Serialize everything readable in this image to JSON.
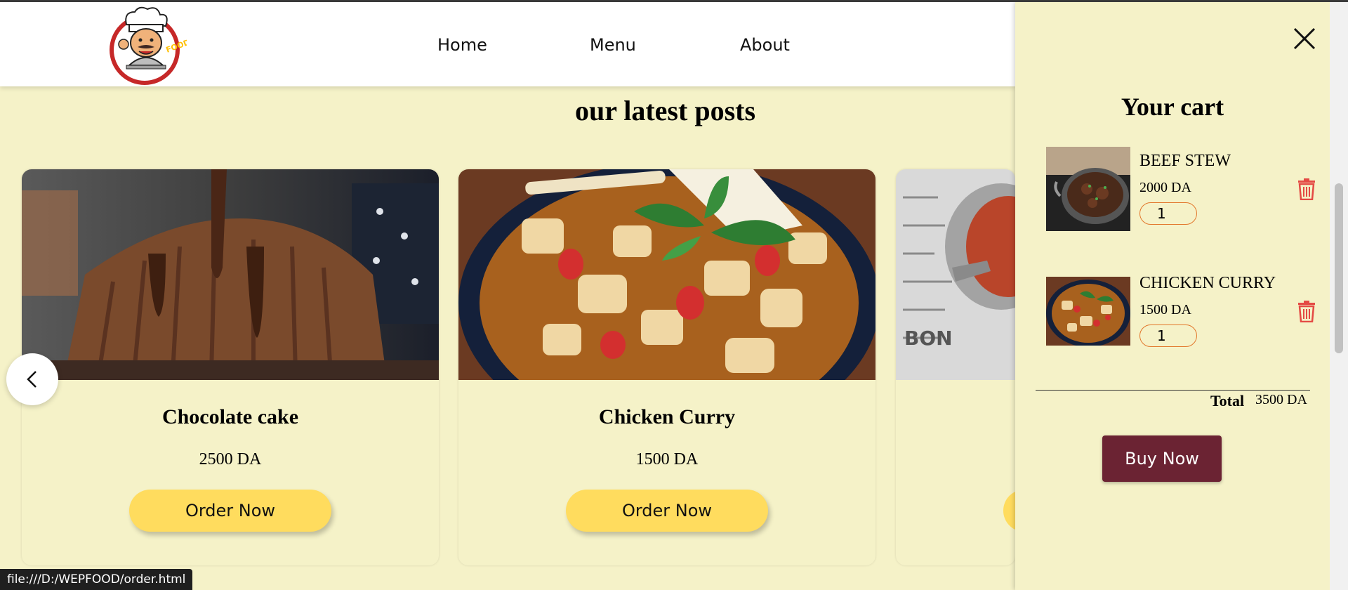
{
  "nav": {
    "logo_alt": "FOOD",
    "links": [
      "Home",
      "Menu",
      "About"
    ]
  },
  "main": {
    "title": "our latest posts",
    "cards": [
      {
        "title": "Chocolate cake",
        "price": "2500 DA",
        "button": "Order Now"
      },
      {
        "title": "Chicken Curry",
        "price": "1500 DA",
        "button": "Order Now"
      },
      {
        "title": "",
        "price": "",
        "button": ""
      }
    ]
  },
  "cart": {
    "title": "Your cart",
    "items": [
      {
        "name": "BEEF STEW",
        "price": "2000 DA",
        "qty": "1"
      },
      {
        "name": "CHICKEN CURRY",
        "price": "1500 DA",
        "qty": "1"
      }
    ],
    "total_label": "Total",
    "total_value": "3500 DA",
    "buy_button": "Buy Now"
  },
  "status_bar": {
    "url": "file:///D:/WEPFOOD/order.html"
  },
  "colors": {
    "page_bg": "#f5f2c8",
    "order_button": "#ffdc5e",
    "buy_button": "#6b2333",
    "trash": "#e44a44",
    "qty_border": "#e2772c"
  }
}
